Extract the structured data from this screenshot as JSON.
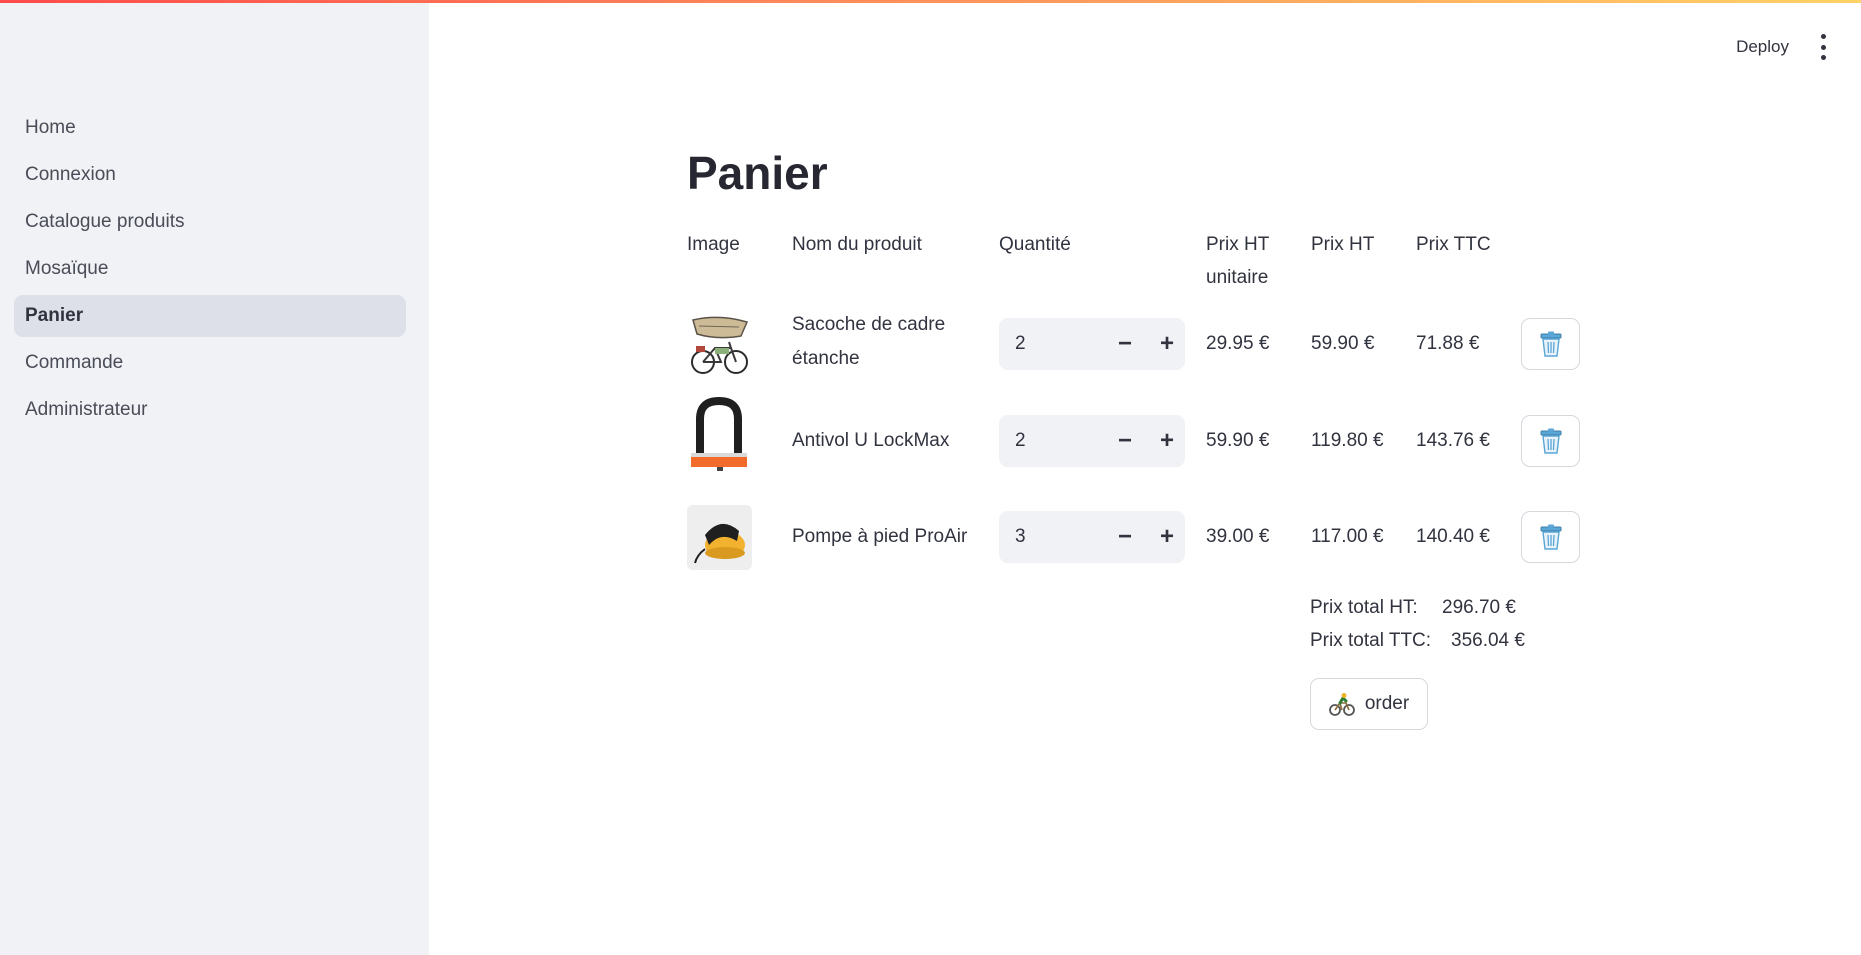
{
  "sidebar": {
    "items": [
      {
        "label": "Home"
      },
      {
        "label": "Connexion"
      },
      {
        "label": "Catalogue produits"
      },
      {
        "label": "Mosaïque"
      },
      {
        "label": "Panier",
        "active": true
      },
      {
        "label": "Commande"
      },
      {
        "label": "Administrateur"
      }
    ]
  },
  "header": {
    "deploy_label": "Deploy",
    "menu_icon": "vertical-ellipsis-icon"
  },
  "page": {
    "title": "Panier"
  },
  "table": {
    "headers": {
      "image": "Image",
      "name": "Nom du produit",
      "quantity": "Quantité",
      "unit_price_line1": "Prix HT",
      "unit_price_line2": "unitaire",
      "price_ht": "Prix HT",
      "price_ttc": "Prix TTC"
    },
    "rows": [
      {
        "name_line1": "Sacoche de cadre",
        "name_line2": "étanche",
        "quantity": "2",
        "unit_price": "29.95 €",
        "price_ht": "59.90 €",
        "price_ttc": "71.88 €",
        "image_icon": "frame-bag-image"
      },
      {
        "name_line1": "Antivol U LockMax",
        "name_line2": "",
        "quantity": "2",
        "unit_price": "59.90 €",
        "price_ht": "119.80 €",
        "price_ttc": "143.76 €",
        "image_icon": "u-lock-image"
      },
      {
        "name_line1": "Pompe à pied ProAir",
        "name_line2": "",
        "quantity": "3",
        "unit_price": "39.00 €",
        "price_ht": "117.00 €",
        "price_ttc": "140.40 €",
        "image_icon": "foot-pump-image"
      }
    ],
    "stepper": {
      "minus": "−",
      "plus": "+"
    },
    "delete_icon": "trash-icon"
  },
  "totals": {
    "ht_label": "Prix total HT:",
    "ht_value": "296.70 €",
    "ttc_label": "Prix total TTC:",
    "ttc_value": "356.04 €"
  },
  "order_button": {
    "label": "order",
    "icon": "cyclist-icon"
  },
  "colors": {
    "accent_gradient_start": "#ff4b4b",
    "accent_gradient_end": "#ffd166",
    "sidebar_bg": "#f0f2f6",
    "active_item_bg": "#dde0e8"
  }
}
